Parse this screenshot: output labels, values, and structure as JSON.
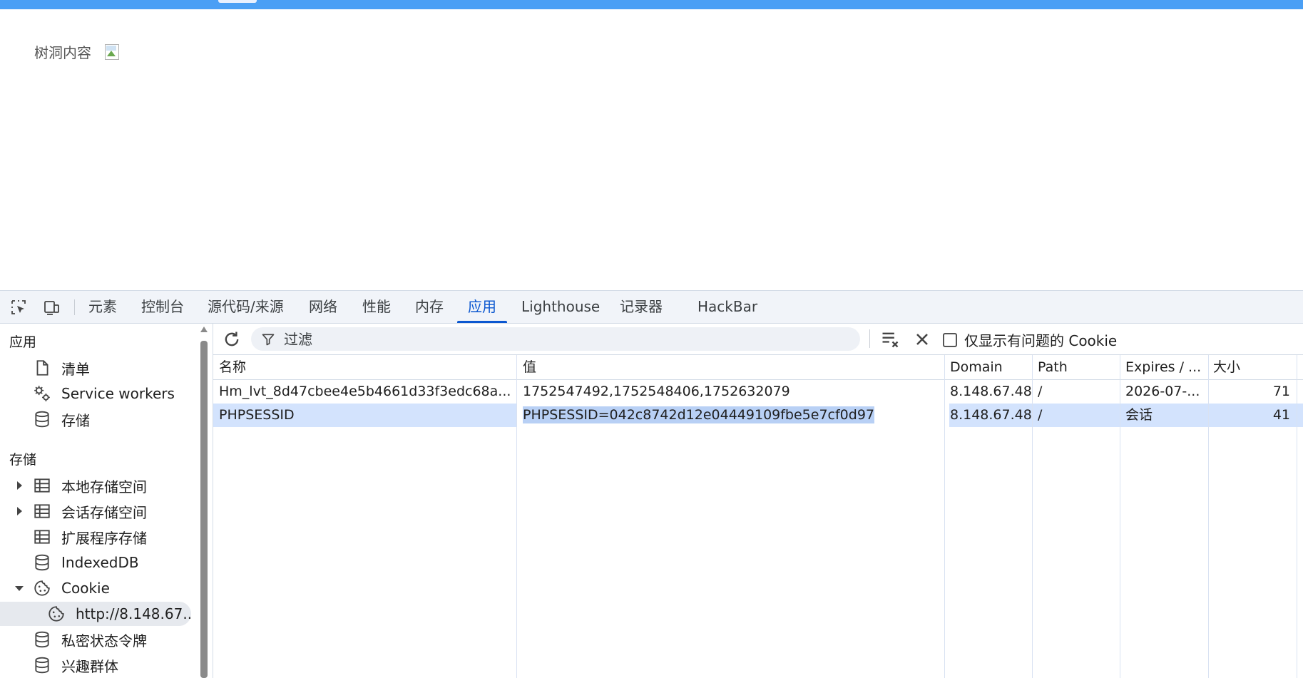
{
  "page": {
    "label": "树洞内容"
  },
  "devtools": {
    "tabs": [
      {
        "label": "元素"
      },
      {
        "label": "控制台"
      },
      {
        "label": "源代码/来源"
      },
      {
        "label": "网络"
      },
      {
        "label": "性能"
      },
      {
        "label": "内存"
      },
      {
        "label": "应用"
      },
      {
        "label": "Lighthouse"
      },
      {
        "label": "记录器"
      },
      {
        "label": "HackBar"
      }
    ],
    "active_tab": "应用",
    "sidebar": {
      "section_app": "应用",
      "app_items": [
        {
          "label": "清单",
          "icon": "document-icon"
        },
        {
          "label": "Service workers",
          "icon": "gears-icon"
        },
        {
          "label": "存储",
          "icon": "database-icon"
        }
      ],
      "section_storage": "存储",
      "storage_items": [
        {
          "label": "本地存储空间",
          "icon": "table-icon",
          "expandable": true
        },
        {
          "label": "会话存储空间",
          "icon": "table-icon",
          "expandable": true
        },
        {
          "label": "扩展程序存储",
          "icon": "table-icon"
        },
        {
          "label": "IndexedDB",
          "icon": "database-icon"
        },
        {
          "label": "Cookie",
          "icon": "cookie-icon",
          "expanded": true
        },
        {
          "label": "http://8.148.67...",
          "icon": "cookie-icon",
          "selected": true
        },
        {
          "label": "私密状态令牌",
          "icon": "database-icon"
        },
        {
          "label": "兴趣群体",
          "icon": "database-icon"
        }
      ]
    },
    "filter": {
      "placeholder": "过滤",
      "only_issues_label": "仅显示有问题的 Cookie",
      "only_issues_checked": false
    },
    "cookies": {
      "columns": [
        "名称",
        "值",
        "Domain",
        "Path",
        "Expires / ...",
        "大小"
      ],
      "rows": [
        {
          "name": "Hm_lvt_8d47cbee4e5b4661d33f3edc68a...",
          "value": "1752547492,1752548406,1752632079",
          "domain": "8.148.67.48",
          "path": "/",
          "expires": "2026-07-...",
          "size": "71",
          "selected": false
        },
        {
          "name": "PHPSESSID",
          "value": "PHPSESSID=042c8742d12e04449109fbe5e7cf0d97",
          "domain": "8.148.67.48",
          "path": "/",
          "expires": "会话",
          "size": "41",
          "selected": true
        }
      ]
    },
    "colors": {
      "accent": "#0b57d0",
      "selected_row": "#d3e3fd",
      "topbar": "#4a9ff5"
    }
  }
}
